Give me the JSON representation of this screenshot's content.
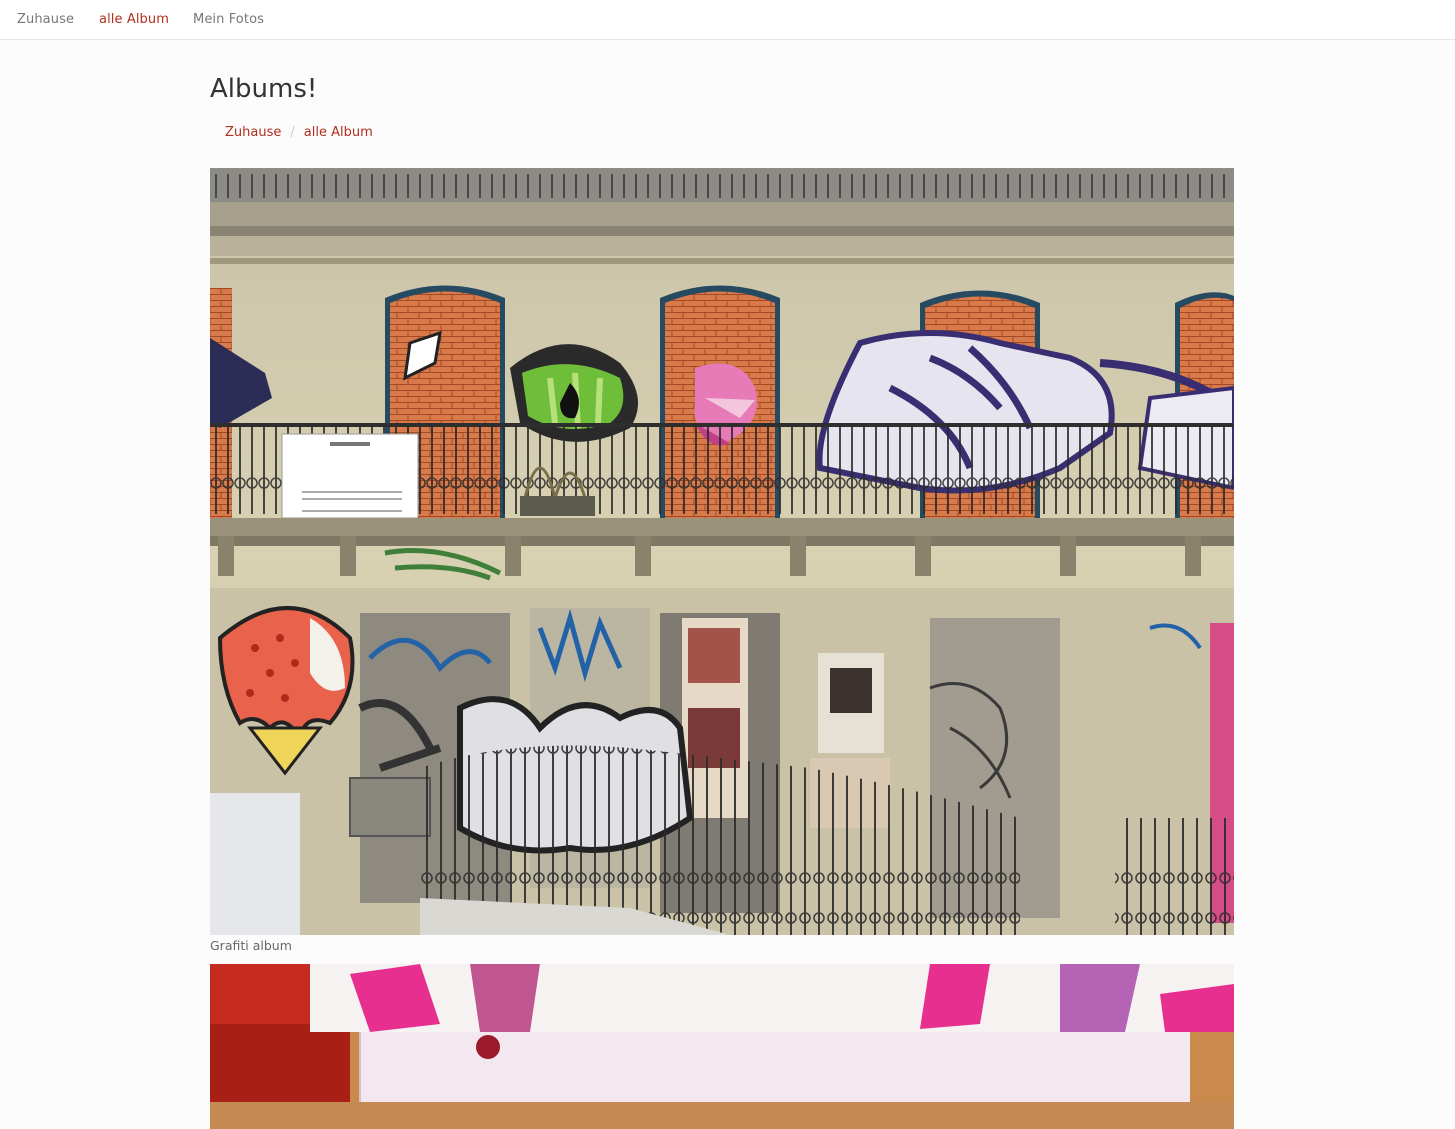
{
  "nav": {
    "home": "Zuhause",
    "albums": "alle Album",
    "photos": "Mein Fotos"
  },
  "page": {
    "title": "Albums!"
  },
  "breadcrumb": {
    "home": "Zuhause",
    "current": "alle Album",
    "separator": "/"
  },
  "albums": [
    {
      "caption": "Grafiti album"
    },
    {
      "caption": ""
    }
  ],
  "colors": {
    "accent": "#b0301f",
    "nav_text": "#777777",
    "background": "#fcfcfc"
  }
}
